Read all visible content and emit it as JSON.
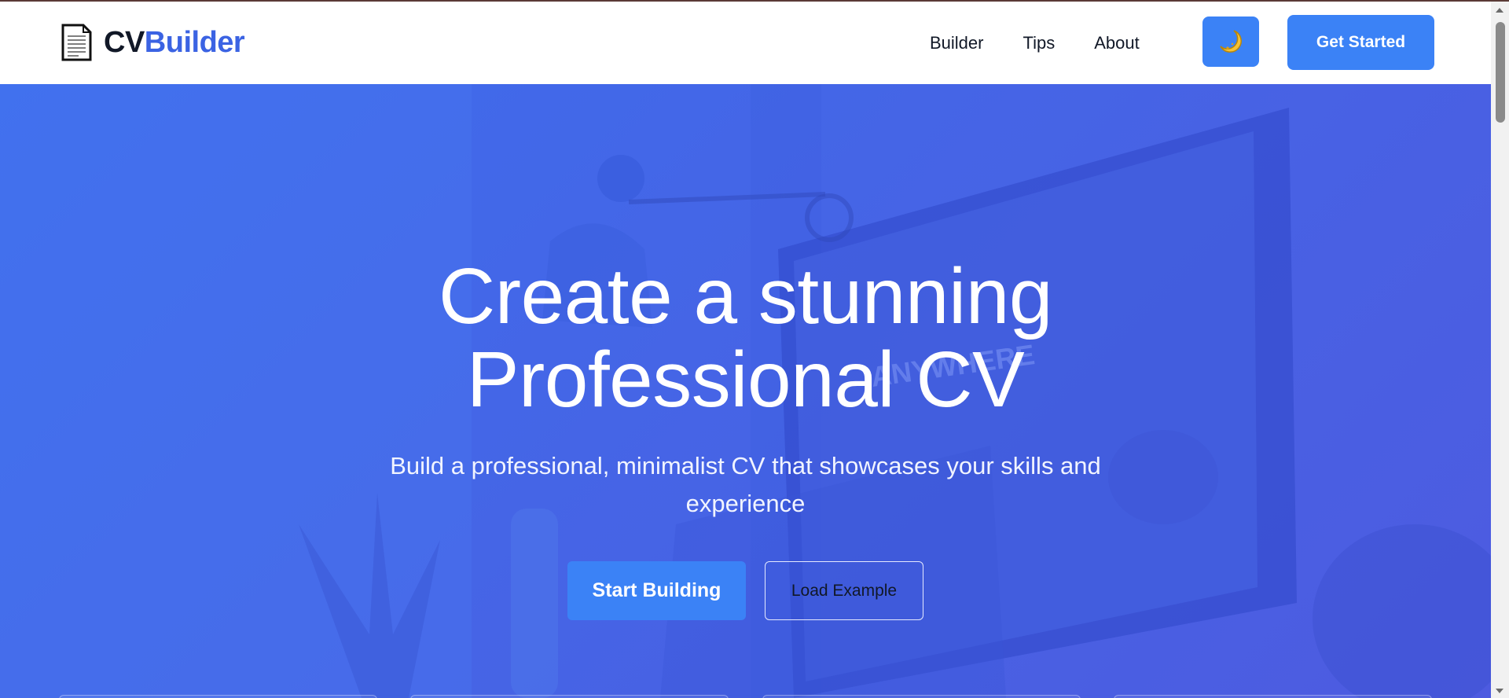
{
  "brand": {
    "name_part1": "CV",
    "name_part2": "Builder",
    "icon": "document-icon",
    "colors": {
      "dark": "#111827",
      "accent": "#3b63e3"
    }
  },
  "nav": {
    "items": [
      {
        "label": "Builder"
      },
      {
        "label": "Tips"
      },
      {
        "label": "About"
      }
    ],
    "theme_toggle_icon": "moon-icon",
    "cta_label": "Get Started"
  },
  "hero": {
    "title_line1": "Create a stunning",
    "title_line2": "Professional CV",
    "subtitle": "Build a professional, minimalist CV that showcases your skills and experience",
    "primary_button": "Start Building",
    "secondary_button": "Load Example",
    "background_image": "desk-workspace-photo",
    "colors": {
      "gradient_start": "#3d6ded",
      "gradient_end": "#4d5be0",
      "button": "#3b82f6"
    }
  }
}
